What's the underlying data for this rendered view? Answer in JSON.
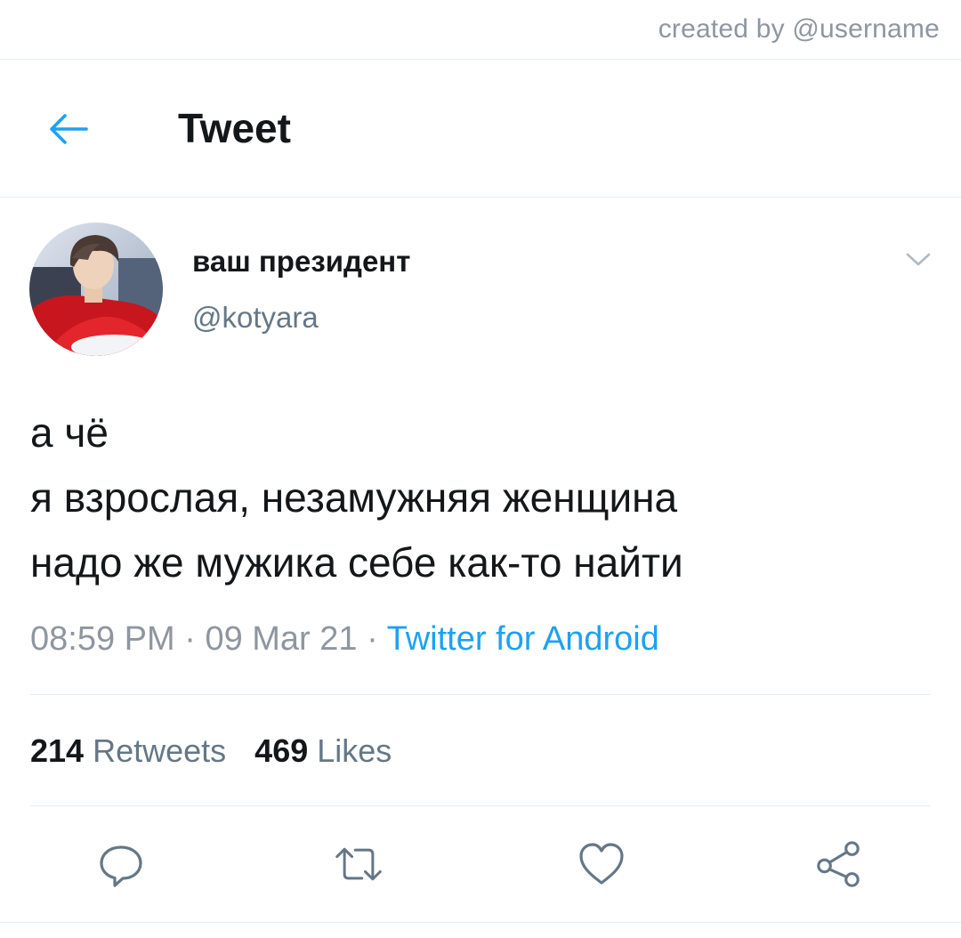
{
  "credit": "created by @username",
  "header": {
    "title": "Tweet",
    "back_icon": "arrow-left-icon"
  },
  "author": {
    "display_name": "ваш президент",
    "handle": "@kotyara"
  },
  "tweet": {
    "lines": [
      "а чё",
      "я взрослая, незамужняя женщина",
      "надо же мужика себе как-то найти"
    ],
    "time": "08:59 PM",
    "separator": "·",
    "date": "09 Mar 21",
    "source": "Twitter for Android"
  },
  "stats": {
    "retweets_count": "214",
    "retweets_label": "Retweets",
    "likes_count": "469",
    "likes_label": "Likes"
  },
  "actions": [
    "reply-icon",
    "retweet-icon",
    "like-icon",
    "share-icon"
  ],
  "colors": {
    "accent": "#1da1f2",
    "text": "#14171a",
    "muted": "#657786",
    "divider": "#e6ecf0"
  }
}
